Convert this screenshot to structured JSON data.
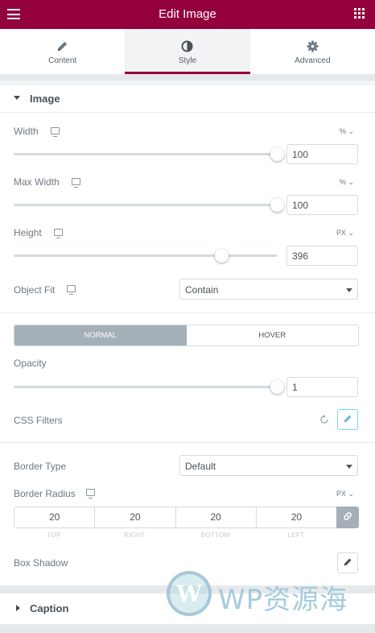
{
  "header": {
    "title": "Edit Image"
  },
  "tabs": [
    {
      "label": "Content",
      "icon": "pencil-icon",
      "active": false
    },
    {
      "label": "Style",
      "icon": "contrast-icon",
      "active": true
    },
    {
      "label": "Advanced",
      "icon": "gear-icon",
      "active": false
    }
  ],
  "image_section": {
    "title": "Image",
    "width": {
      "label": "Width",
      "unit": "%",
      "value": "100",
      "level": 1.0
    },
    "max_width": {
      "label": "Max Width",
      "unit": "%",
      "value": "100",
      "level": 1.0
    },
    "height": {
      "label": "Height",
      "unit": "PX",
      "value": "396",
      "level": 0.79
    },
    "object_fit": {
      "label": "Object Fit",
      "value": "Contain"
    }
  },
  "state_toggle": {
    "normal": "NORMAL",
    "hover": "HOVER",
    "active": "NORMAL"
  },
  "opacity": {
    "label": "Opacity",
    "value": "1",
    "level": 1.0
  },
  "css_filters": {
    "label": "CSS Filters"
  },
  "border": {
    "type_label": "Border Type",
    "type_value": "Default",
    "radius_label": "Border Radius",
    "radius_unit": "PX",
    "top": "20",
    "right": "20",
    "bottom": "20",
    "left": "20",
    "top_label": "TOP",
    "right_label": "RIGHT",
    "bottom_label": "BOTTOM",
    "left_label": "LEFT"
  },
  "box_shadow": {
    "label": "Box Shadow"
  },
  "caption_section": {
    "title": "Caption"
  },
  "watermark": {
    "text": "WP资源海",
    "logo_letter": "W"
  },
  "colors": {
    "accent": "#93003c",
    "toggle_active": "#a4afb7"
  }
}
